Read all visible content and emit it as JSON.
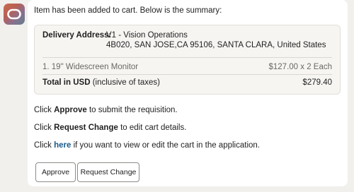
{
  "message": {
    "intro": "Item has been added to cart. Below is the summary:"
  },
  "summary": {
    "delivery_label": "Delivery Address:",
    "address_line1": "V1 - Vision Operations",
    "address_line2": "4B020, SAN JOSE,CA 95106, SANTA CLARA, United States",
    "items": [
      {
        "name": "1. 19\" Widescreen Monitor",
        "price": "$127.00 x 2 Each"
      }
    ],
    "total_label": "Total in USD",
    "total_note": "(inclusive of taxes)",
    "total_value": "$279.40"
  },
  "instructions": {
    "approve_prefix": "Click ",
    "approve_keyword": "Approve",
    "approve_suffix": " to submit the requisition.",
    "change_prefix": "Click ",
    "change_keyword": "Request Change",
    "change_suffix": " to edit cart details.",
    "here_prefix": "Click ",
    "here_link": "here",
    "here_suffix": " if you want to view or edit the cart in the application."
  },
  "actions": {
    "approve_label": "Approve",
    "request_change_label": "Request Change"
  },
  "icons": {
    "avatar": "assistant-logo-icon"
  },
  "colors": {
    "link": "#1a5a8a",
    "avatar_gradient_start": "#c96b4a",
    "avatar_gradient_end": "#5f7f8f"
  }
}
